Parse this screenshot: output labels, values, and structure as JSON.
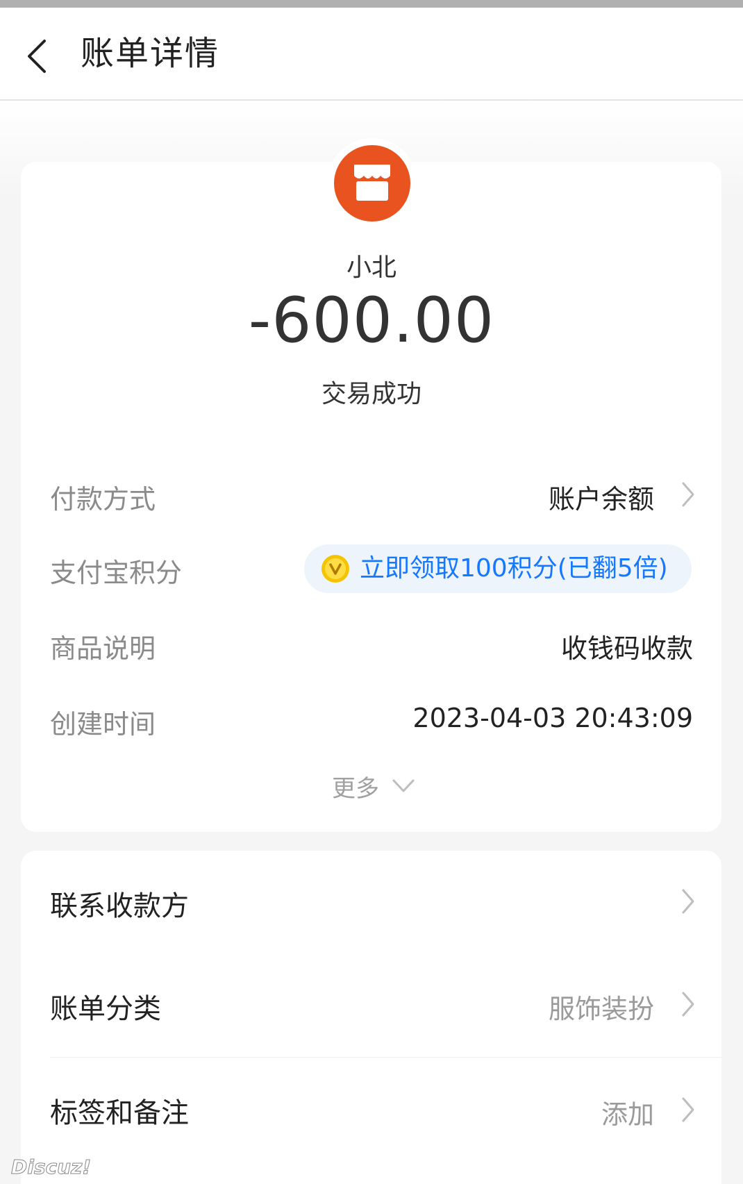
{
  "navbar": {
    "title": "账单详情"
  },
  "merchant": {
    "name": "小北",
    "logo_icon": "store-icon",
    "logo_color": "#e8531f"
  },
  "transaction": {
    "amount": "-600.00",
    "status": "交易成功"
  },
  "details": {
    "payment_method": {
      "label": "付款方式",
      "value": "账户余额"
    },
    "points": {
      "label": "支付宝积分",
      "value": "立即领取100积分(已翻5倍)",
      "accent": "#1677ff"
    },
    "description": {
      "label": "商品说明",
      "value": "收钱码收款"
    },
    "created_time": {
      "label": "创建时间",
      "value": "2023-04-03 20:43:09"
    },
    "more_label": "更多"
  },
  "actions": {
    "contact": {
      "label": "联系收款方"
    },
    "category": {
      "label": "账单分类",
      "value": "服饰装扮"
    },
    "tags": {
      "label": "标签和备注",
      "value": "添加"
    }
  },
  "watermark": "Discuz!"
}
